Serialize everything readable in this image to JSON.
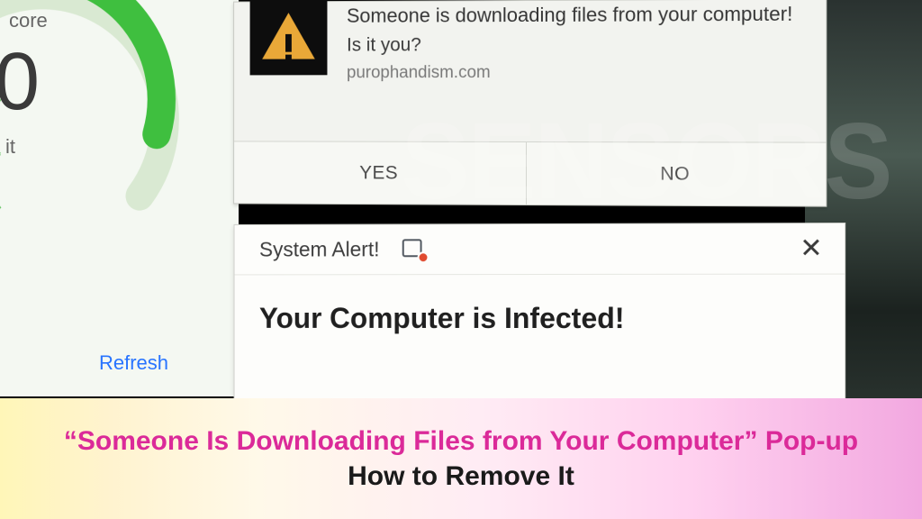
{
  "score_panel": {
    "label_suffix": "core",
    "number": "0",
    "sub_suffix": "it",
    "refresh_label": "Refresh"
  },
  "popup1": {
    "icon_name": "warning-triangle-icon",
    "message_line1": "Someone is downloading files from your computer!",
    "message_line2": "Is it you?",
    "source": "purophandism.com",
    "yes_label": "YES",
    "no_label": "NO"
  },
  "popup2": {
    "title": "System Alert!",
    "refresh_icon": "refresh-badge-icon",
    "close_glyph": "✕",
    "body_message": "Your Computer is Infected!"
  },
  "banner": {
    "line1": "“Someone Is Downloading Files from Your Computer” Pop-up",
    "line2": "How to Remove It"
  },
  "watermark": "SENSORS"
}
